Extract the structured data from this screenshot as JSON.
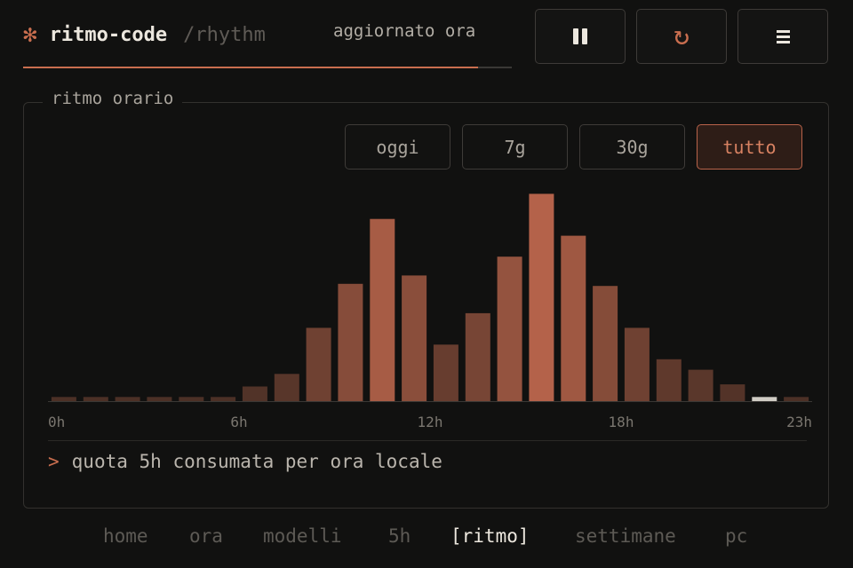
{
  "header": {
    "glyph": "✻",
    "app_title": "ritmo-code",
    "subpath": "/rhythm",
    "status": "aggiornato ora",
    "progress": 0.93
  },
  "toolbar": {
    "pause_icon": "pause-icon",
    "refresh_icon": "refresh-icon",
    "menu_icon": "menu-icon"
  },
  "panel": {
    "legend": "ritmo orario",
    "ranges": [
      "oggi",
      "7g",
      "30g",
      "tutto"
    ],
    "selected_range": "tutto",
    "caption_prompt": ">",
    "caption": "quota 5h consumata per ora locale"
  },
  "chart_data": {
    "type": "bar",
    "categories": [
      "0h",
      "1h",
      "2h",
      "3h",
      "4h",
      "5h",
      "6h",
      "7h",
      "8h",
      "9h",
      "10h",
      "11h",
      "12h",
      "13h",
      "14h",
      "15h",
      "16h",
      "17h",
      "18h",
      "19h",
      "20h",
      "21h",
      "22h",
      "23h"
    ],
    "values": [
      2,
      2,
      2,
      2,
      2,
      2,
      7,
      13,
      35,
      56,
      87,
      60,
      27,
      42,
      69,
      99,
      79,
      55,
      35,
      20,
      15,
      8,
      2,
      2
    ],
    "x_tick_labels": [
      "0h",
      "6h",
      "12h",
      "18h",
      "23h"
    ],
    "highlighted_category": "22h",
    "ylim": [
      0,
      100
    ],
    "grid": false,
    "colors": {
      "low": "#4a2f25",
      "high": "#b5634a",
      "highlight": "#d0ccc4",
      "baseline": "#3a3835"
    }
  },
  "nav": {
    "items": [
      "home",
      "ora",
      "modelli",
      "5h",
      "[ritmo]",
      "settimane",
      "pc"
    ],
    "active": "[ritmo]"
  }
}
